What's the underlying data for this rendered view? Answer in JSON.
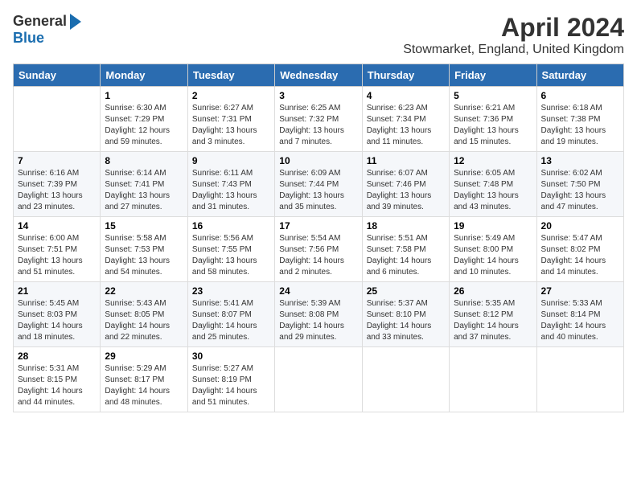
{
  "logo": {
    "general": "General",
    "blue": "Blue"
  },
  "title": "April 2024",
  "location": "Stowmarket, England, United Kingdom",
  "days_header": [
    "Sunday",
    "Monday",
    "Tuesday",
    "Wednesday",
    "Thursday",
    "Friday",
    "Saturday"
  ],
  "weeks": [
    [
      {
        "num": "",
        "info": ""
      },
      {
        "num": "1",
        "info": "Sunrise: 6:30 AM\nSunset: 7:29 PM\nDaylight: 12 hours\nand 59 minutes."
      },
      {
        "num": "2",
        "info": "Sunrise: 6:27 AM\nSunset: 7:31 PM\nDaylight: 13 hours\nand 3 minutes."
      },
      {
        "num": "3",
        "info": "Sunrise: 6:25 AM\nSunset: 7:32 PM\nDaylight: 13 hours\nand 7 minutes."
      },
      {
        "num": "4",
        "info": "Sunrise: 6:23 AM\nSunset: 7:34 PM\nDaylight: 13 hours\nand 11 minutes."
      },
      {
        "num": "5",
        "info": "Sunrise: 6:21 AM\nSunset: 7:36 PM\nDaylight: 13 hours\nand 15 minutes."
      },
      {
        "num": "6",
        "info": "Sunrise: 6:18 AM\nSunset: 7:38 PM\nDaylight: 13 hours\nand 19 minutes."
      }
    ],
    [
      {
        "num": "7",
        "info": "Sunrise: 6:16 AM\nSunset: 7:39 PM\nDaylight: 13 hours\nand 23 minutes."
      },
      {
        "num": "8",
        "info": "Sunrise: 6:14 AM\nSunset: 7:41 PM\nDaylight: 13 hours\nand 27 minutes."
      },
      {
        "num": "9",
        "info": "Sunrise: 6:11 AM\nSunset: 7:43 PM\nDaylight: 13 hours\nand 31 minutes."
      },
      {
        "num": "10",
        "info": "Sunrise: 6:09 AM\nSunset: 7:44 PM\nDaylight: 13 hours\nand 35 minutes."
      },
      {
        "num": "11",
        "info": "Sunrise: 6:07 AM\nSunset: 7:46 PM\nDaylight: 13 hours\nand 39 minutes."
      },
      {
        "num": "12",
        "info": "Sunrise: 6:05 AM\nSunset: 7:48 PM\nDaylight: 13 hours\nand 43 minutes."
      },
      {
        "num": "13",
        "info": "Sunrise: 6:02 AM\nSunset: 7:50 PM\nDaylight: 13 hours\nand 47 minutes."
      }
    ],
    [
      {
        "num": "14",
        "info": "Sunrise: 6:00 AM\nSunset: 7:51 PM\nDaylight: 13 hours\nand 51 minutes."
      },
      {
        "num": "15",
        "info": "Sunrise: 5:58 AM\nSunset: 7:53 PM\nDaylight: 13 hours\nand 54 minutes."
      },
      {
        "num": "16",
        "info": "Sunrise: 5:56 AM\nSunset: 7:55 PM\nDaylight: 13 hours\nand 58 minutes."
      },
      {
        "num": "17",
        "info": "Sunrise: 5:54 AM\nSunset: 7:56 PM\nDaylight: 14 hours\nand 2 minutes."
      },
      {
        "num": "18",
        "info": "Sunrise: 5:51 AM\nSunset: 7:58 PM\nDaylight: 14 hours\nand 6 minutes."
      },
      {
        "num": "19",
        "info": "Sunrise: 5:49 AM\nSunset: 8:00 PM\nDaylight: 14 hours\nand 10 minutes."
      },
      {
        "num": "20",
        "info": "Sunrise: 5:47 AM\nSunset: 8:02 PM\nDaylight: 14 hours\nand 14 minutes."
      }
    ],
    [
      {
        "num": "21",
        "info": "Sunrise: 5:45 AM\nSunset: 8:03 PM\nDaylight: 14 hours\nand 18 minutes."
      },
      {
        "num": "22",
        "info": "Sunrise: 5:43 AM\nSunset: 8:05 PM\nDaylight: 14 hours\nand 22 minutes."
      },
      {
        "num": "23",
        "info": "Sunrise: 5:41 AM\nSunset: 8:07 PM\nDaylight: 14 hours\nand 25 minutes."
      },
      {
        "num": "24",
        "info": "Sunrise: 5:39 AM\nSunset: 8:08 PM\nDaylight: 14 hours\nand 29 minutes."
      },
      {
        "num": "25",
        "info": "Sunrise: 5:37 AM\nSunset: 8:10 PM\nDaylight: 14 hours\nand 33 minutes."
      },
      {
        "num": "26",
        "info": "Sunrise: 5:35 AM\nSunset: 8:12 PM\nDaylight: 14 hours\nand 37 minutes."
      },
      {
        "num": "27",
        "info": "Sunrise: 5:33 AM\nSunset: 8:14 PM\nDaylight: 14 hours\nand 40 minutes."
      }
    ],
    [
      {
        "num": "28",
        "info": "Sunrise: 5:31 AM\nSunset: 8:15 PM\nDaylight: 14 hours\nand 44 minutes."
      },
      {
        "num": "29",
        "info": "Sunrise: 5:29 AM\nSunset: 8:17 PM\nDaylight: 14 hours\nand 48 minutes."
      },
      {
        "num": "30",
        "info": "Sunrise: 5:27 AM\nSunset: 8:19 PM\nDaylight: 14 hours\nand 51 minutes."
      },
      {
        "num": "",
        "info": ""
      },
      {
        "num": "",
        "info": ""
      },
      {
        "num": "",
        "info": ""
      },
      {
        "num": "",
        "info": ""
      }
    ]
  ]
}
